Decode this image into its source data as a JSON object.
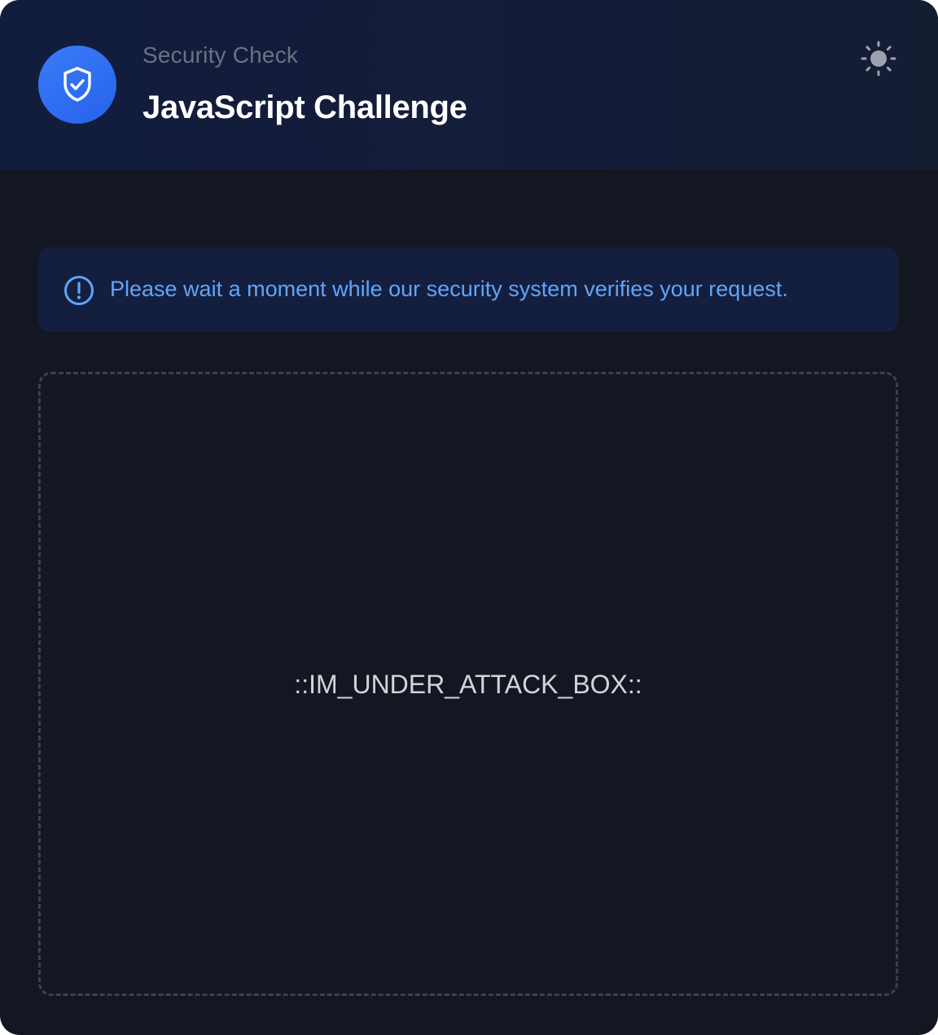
{
  "header": {
    "subtitle": "Security Check",
    "title": "JavaScript Challenge",
    "badge_icon": "shield-check-icon",
    "theme_toggle_icon": "sun-icon"
  },
  "notice": {
    "icon": "info-circle-icon",
    "text": "Please wait a moment while our security system verifies your request."
  },
  "challenge_box": {
    "placeholder": "::IM_UNDER_ATTACK_BOX::"
  },
  "colors": {
    "background": "#131722",
    "header_background": "#131c3a",
    "accent": "#2563eb",
    "notice_background": "#141f3f",
    "notice_text": "#60a5fa",
    "subtitle": "#6b7280",
    "title": "#ffffff",
    "dashed_border": "#394150"
  }
}
